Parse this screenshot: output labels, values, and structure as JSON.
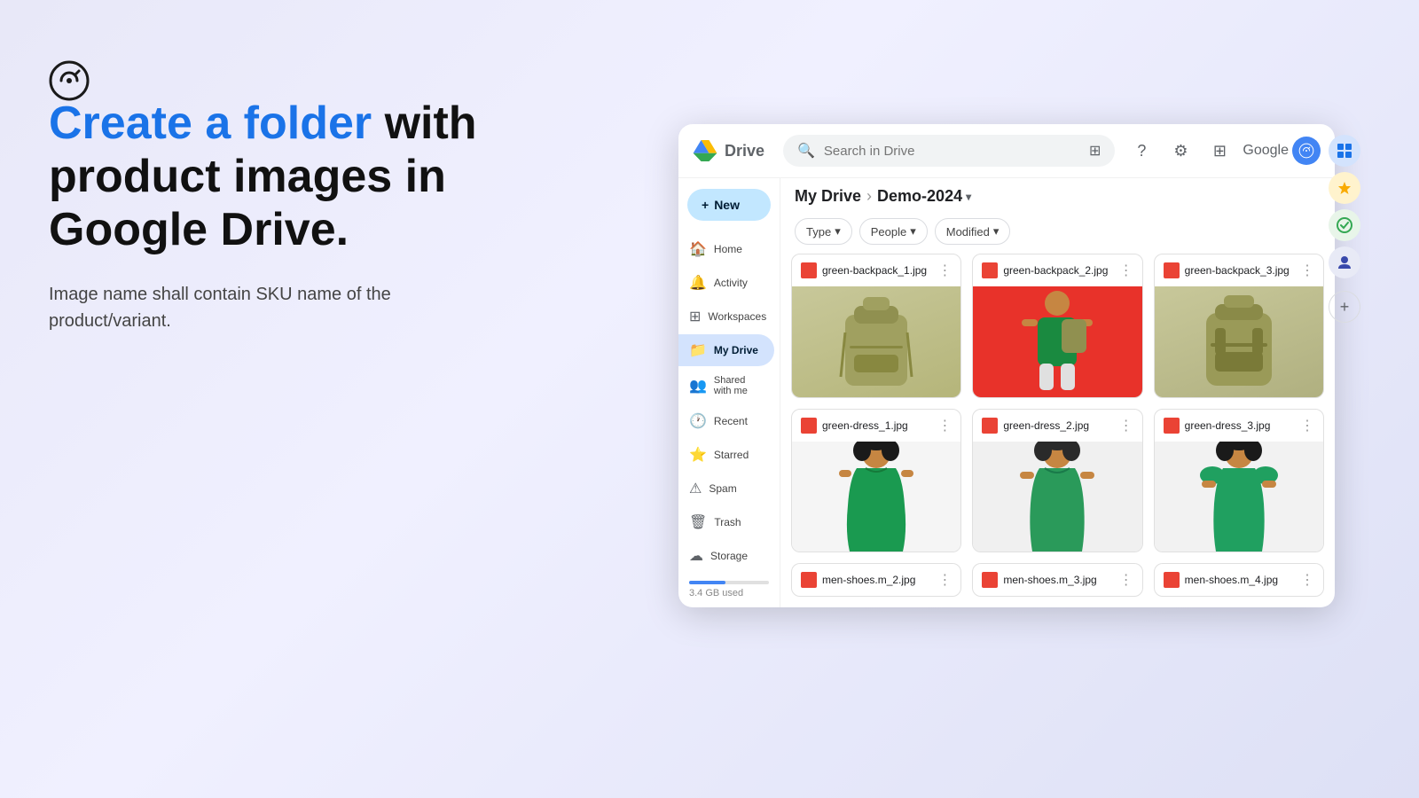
{
  "logo": {
    "alt": "Clipper logo"
  },
  "left_panel": {
    "headline_blue": "Create a folder",
    "headline_rest": " with\nproduct images in\nGoogle Drive.",
    "subtext": "Image name shall contain SKU name of the\nproduct/variant."
  },
  "drive": {
    "title": "Drive",
    "search_placeholder": "Search in Drive",
    "header_icons": [
      "help-icon",
      "settings-icon",
      "apps-icon"
    ],
    "google_label": "Google",
    "new_button": "New",
    "sidebar": [
      {
        "id": "home",
        "label": "Home",
        "icon": "🏠"
      },
      {
        "id": "activity",
        "label": "Activity",
        "icon": "🔔"
      },
      {
        "id": "workspaces",
        "label": "Workspaces",
        "icon": "⊞"
      },
      {
        "id": "my-drive",
        "label": "My Drive",
        "icon": "📁",
        "active": true
      },
      {
        "id": "shared",
        "label": "Shared with me",
        "icon": "👥"
      },
      {
        "id": "recent",
        "label": "Recent",
        "icon": "🕐"
      },
      {
        "id": "starred",
        "label": "Starred",
        "icon": "⭐"
      },
      {
        "id": "spam",
        "label": "Spam",
        "icon": "⚠"
      },
      {
        "id": "trash",
        "label": "Trash",
        "icon": "🗑"
      },
      {
        "id": "storage",
        "label": "Storage",
        "icon": "☁"
      }
    ],
    "storage_used": "3.4 GB used",
    "breadcrumb": {
      "parent": "My Drive",
      "separator": "›",
      "current": "Demo-2024"
    },
    "filters": [
      {
        "label": "Type",
        "has_arrow": true
      },
      {
        "label": "People",
        "has_arrow": true
      },
      {
        "label": "Modified",
        "has_arrow": true
      }
    ],
    "files": [
      {
        "name": "green-backpack_1.jpg",
        "type": "jpg",
        "thumb": "backpack1"
      },
      {
        "name": "green-backpack_2.jpg",
        "type": "jpg",
        "thumb": "backpack2"
      },
      {
        "name": "green-backpack_3.jpg",
        "type": "jpg",
        "thumb": "backpack3"
      },
      {
        "name": "green-dress_1.jpg",
        "type": "jpg",
        "thumb": "dress1"
      },
      {
        "name": "green-dress_2.jpg",
        "type": "jpg",
        "thumb": "dress2"
      },
      {
        "name": "green-dress_3.jpg",
        "type": "jpg",
        "thumb": "dress3"
      },
      {
        "name": "men-shoes.m_2.jpg",
        "type": "jpg",
        "thumb": "shoes1"
      },
      {
        "name": "men-shoes.m_3.jpg",
        "type": "jpg",
        "thumb": "shoes2"
      },
      {
        "name": "men-shoes.m_4.jpg",
        "type": "jpg",
        "thumb": "shoes3"
      }
    ],
    "right_panel_icons": [
      "grid-icon",
      "star-icon",
      "check-icon",
      "person-icon",
      "add-icon"
    ]
  }
}
